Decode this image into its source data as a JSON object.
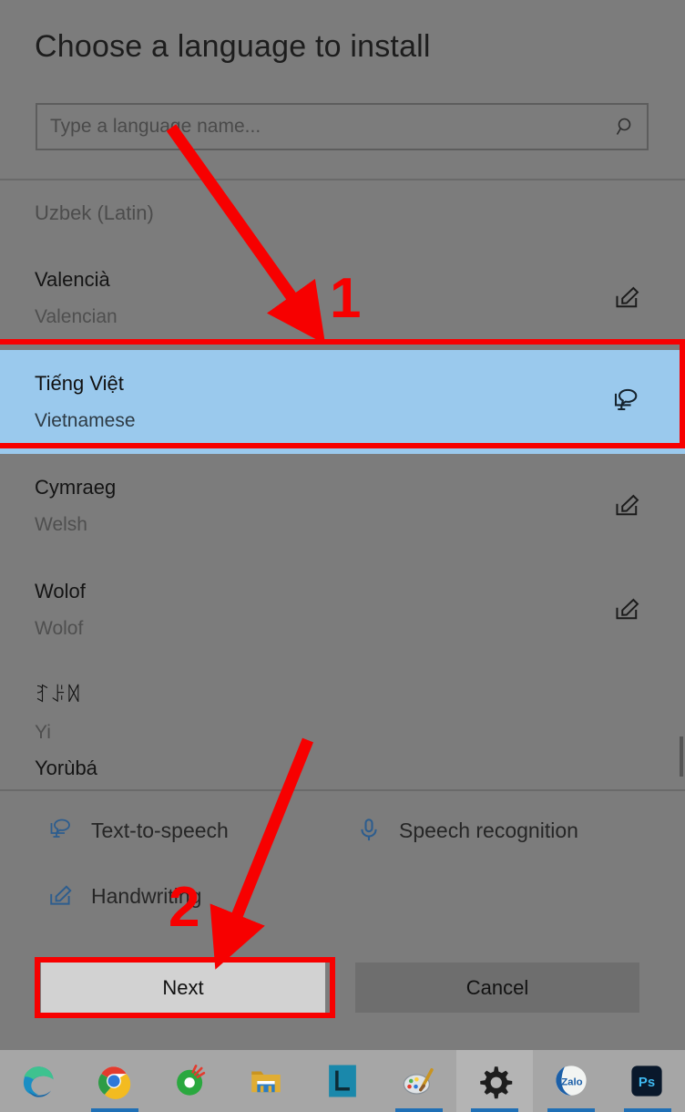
{
  "dialog": {
    "title": "Choose a language to install",
    "search": {
      "placeholder": "Type a language name...",
      "value": "",
      "icon": "search-icon"
    },
    "languages": [
      {
        "native": "Uzbek (Latin)",
        "english": "",
        "icon": "",
        "selected": false,
        "style": "short-muted"
      },
      {
        "native": "Valencià",
        "english": "Valencian",
        "icon": "handwriting-icon",
        "selected": false,
        "style": "normal"
      },
      {
        "native": "Tiếng Việt",
        "english": "Vietnamese",
        "icon": "text-to-speech-icon",
        "selected": true,
        "style": "normal"
      },
      {
        "native": "Cymraeg",
        "english": "Welsh",
        "icon": "handwriting-icon",
        "selected": false,
        "style": "normal"
      },
      {
        "native": "Wolof",
        "english": "Wolof",
        "icon": "handwriting-icon",
        "selected": false,
        "style": "normal"
      },
      {
        "native": "ꆈꌠꉙ",
        "english": "Yi",
        "icon": "",
        "selected": false,
        "style": "normal"
      }
    ],
    "clipped_row": {
      "native": "Yorùbá"
    },
    "legend": [
      {
        "label": "Text-to-speech",
        "icon": "text-to-speech-icon"
      },
      {
        "label": "Speech recognition",
        "icon": "microphone-icon"
      },
      {
        "label": "Handwriting",
        "icon": "handwriting-icon"
      }
    ],
    "buttons": {
      "next": "Next",
      "cancel": "Cancel"
    }
  },
  "annotations": {
    "step1": "1",
    "step2": "2",
    "color": "#f70000"
  },
  "taskbar": {
    "items": [
      {
        "name": "microsoft-edge",
        "active": false
      },
      {
        "name": "google-chrome",
        "active": true
      },
      {
        "name": "coccoc-browser",
        "active": false
      },
      {
        "name": "file-explorer",
        "active": false
      },
      {
        "name": "lightroom-app",
        "active": false
      },
      {
        "name": "paint",
        "active": true
      },
      {
        "name": "settings",
        "active": true
      },
      {
        "name": "zalo",
        "active": true
      },
      {
        "name": "photoshop",
        "active": true
      }
    ]
  },
  "colors": {
    "background": "#7c7c7c",
    "selection": "#9ac9ed",
    "accent_red": "#f70000",
    "legend_icon_blue": "#2d5d8e",
    "next_button": "#d2d2d2",
    "cancel_button": "#6e6e6e"
  }
}
